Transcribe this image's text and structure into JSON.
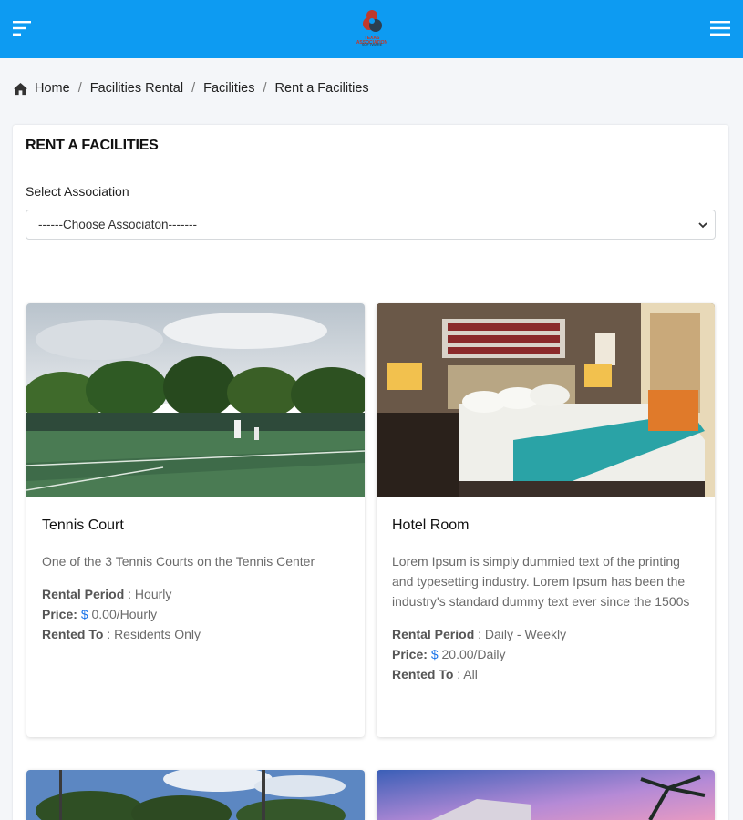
{
  "logo": {
    "line1": "TEXAS ASSOCIATION",
    "line2": "SOFTWARE"
  },
  "breadcrumb": [
    "Home",
    "Facilities Rental",
    "Facilities",
    "Rent a Facilities"
  ],
  "page": {
    "title": "RENT A FACILITIES",
    "select_label": "Select Association",
    "select_value": "------Choose Associaton-------"
  },
  "labels": {
    "rental_period": "Rental Period",
    "price": "Price:",
    "rented_to": "Rented To",
    "currency": "$"
  },
  "facilities": [
    {
      "title": "Tennis Court",
      "description": "One of the 3 Tennis Courts on the Tennis Center",
      "rental_period": " : Hourly",
      "price": " 0.00/Hourly",
      "rented_to": " : Residents Only"
    },
    {
      "title": "Hotel Room",
      "description": "Lorem Ipsum is simply dummied text of the printing and typesetting industry. Lorem Ipsum has been the industry's standard dummy text ever since the 1500s",
      "rental_period": " : Daily - Weekly",
      "price": " 20.00/Daily",
      "rented_to": " : All"
    }
  ],
  "colors": {
    "topbar": "#0d9bf2",
    "link_dollar": "#1a73e8"
  },
  "icons": [
    "sidebar-toggle-icon",
    "menu-icon",
    "home-icon",
    "chevron-down-icon"
  ]
}
